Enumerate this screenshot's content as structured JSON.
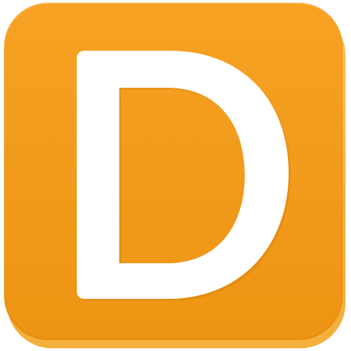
{
  "app_icon": {
    "icon": "letter-d-app-icon",
    "letter": "D",
    "colors": {
      "tile": "#f29c1d",
      "tile_light": "#f8a224",
      "tile_dark": "#ee9413",
      "letter": "#ffffff"
    }
  }
}
